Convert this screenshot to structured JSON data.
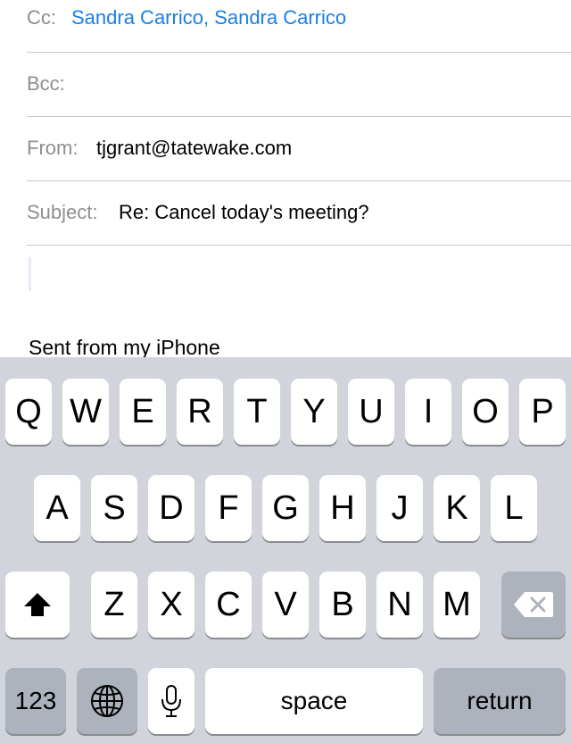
{
  "compose": {
    "cc": {
      "label": "Cc:",
      "value": "Sandra Carrico, Sandra Carrico"
    },
    "bcc": {
      "label": "Bcc:",
      "value": ""
    },
    "from": {
      "label": "From:",
      "value": "tjgrant@tatewake.com"
    },
    "subject": {
      "label": "Subject:",
      "value": "Re: Cancel today's meeting?"
    },
    "body": {
      "signature": "Sent from my iPhone"
    }
  },
  "keyboard": {
    "row1": [
      "Q",
      "W",
      "E",
      "R",
      "T",
      "Y",
      "U",
      "I",
      "O",
      "P"
    ],
    "row2": [
      "A",
      "S",
      "D",
      "F",
      "G",
      "H",
      "J",
      "K",
      "L"
    ],
    "row3": [
      "Z",
      "X",
      "C",
      "V",
      "B",
      "N",
      "M"
    ],
    "numbers_label": "123",
    "space_label": "space",
    "return_label": "return",
    "icons": {
      "shift": "shift-icon",
      "delete": "delete-icon",
      "globe": "globe-icon",
      "mic": "microphone-icon"
    }
  }
}
